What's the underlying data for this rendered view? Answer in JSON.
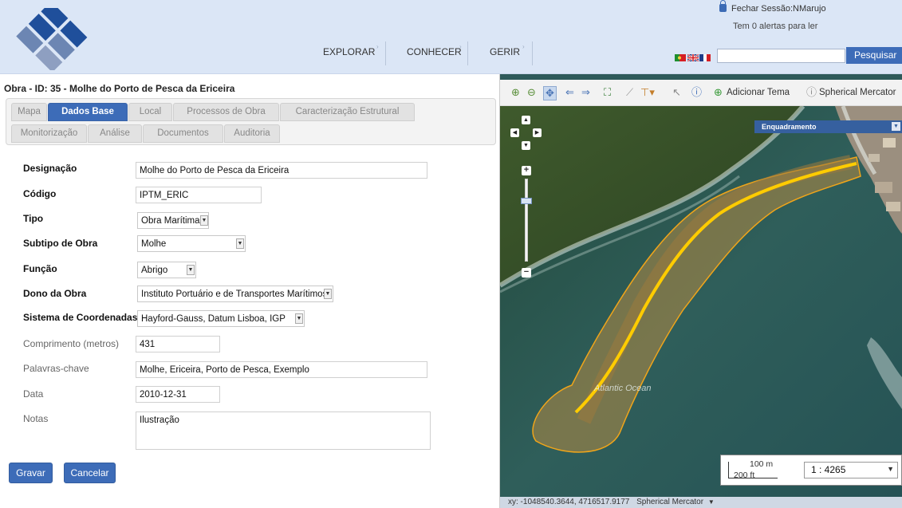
{
  "header": {
    "logout_text": "Fechar Sessão:NMarujo",
    "alerts_text": "Tem 0 alertas para ler",
    "search_button": "Pesquisar",
    "search_value": "",
    "nav": [
      {
        "label": "EXPLORAR"
      },
      {
        "label": "CONHECER"
      },
      {
        "label": "GERIR"
      }
    ],
    "flags": [
      "portugal-flag-icon",
      "uk-flag-icon",
      "france-flag-icon"
    ]
  },
  "form": {
    "title": "Obra - ID: 35 - Molhe do Porto de Pesca da Ericeira",
    "tabs_row1": [
      "Mapa",
      "Dados Base",
      "Local",
      "Processos de Obra",
      "Caracterização Estrutural"
    ],
    "tabs_row2": [
      "Monitorização",
      "Análise",
      "Documentos",
      "Auditoria"
    ],
    "active_tab": "Dados Base",
    "fields": {
      "designacao": {
        "label": "Designação",
        "value": "Molhe do Porto de Pesca da Ericeira"
      },
      "codigo": {
        "label": "Código",
        "value": "IPTM_ERIC"
      },
      "tipo": {
        "label": "Tipo",
        "value": "Obra Marítima"
      },
      "subtipo": {
        "label": "Subtipo de Obra",
        "value": "Molhe"
      },
      "funcao": {
        "label": "Função",
        "value": "Abrigo"
      },
      "dono": {
        "label": "Dono da Obra",
        "value": "Instituto Portuário e de Transportes Marítimos"
      },
      "sistema": {
        "label": "Sistema de Coordenadas",
        "value": "Hayford-Gauss, Datum Lisboa, IGP"
      },
      "comprimento": {
        "label": "Comprimento (metros)",
        "value": "431"
      },
      "palavras": {
        "label": "Palavras-chave",
        "value": "Molhe, Ericeira, Porto de Pesca, Exemplo"
      },
      "data": {
        "label": "Data",
        "value": "2010-12-31"
      },
      "notas": {
        "label": "Notas",
        "value": "Ilustração"
      }
    },
    "buttons": {
      "save": "Gravar",
      "cancel": "Cancelar"
    }
  },
  "map": {
    "toolbar": {
      "add_theme": "Adicionar Tema",
      "projection": "Spherical Mercator"
    },
    "layer_selector": "Enquadramento",
    "ocean_label": "Atlantic Ocean",
    "scale": {
      "metric": "100 m",
      "imperial": "200 ft",
      "ratio": "1 : 4265"
    },
    "coords_text": "xy: -1048540.3644, 4716517.9177",
    "coords_projection": "Spherical Mercator",
    "colors": {
      "water": "#2f5e5a",
      "breakwater": "#b18a45",
      "outline": "#e6a21a",
      "axis": "#ffcc00"
    }
  }
}
